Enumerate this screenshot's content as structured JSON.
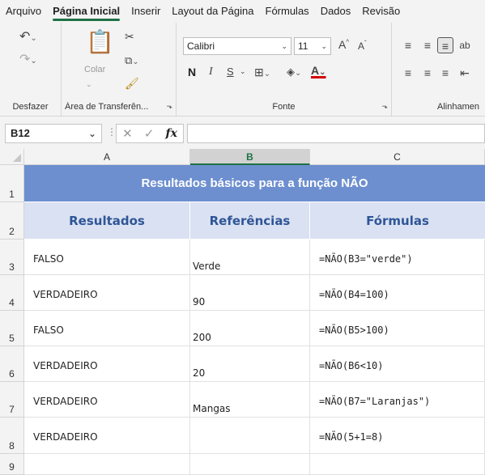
{
  "menu": [
    "Arquivo",
    "Página Inicial",
    "Inserir",
    "Layout da Página",
    "Fórmulas",
    "Dados",
    "Revisão"
  ],
  "ribbon": {
    "undo_group_label": "Desfazer",
    "clipboard": {
      "label": "Área de Transferên...",
      "paste": "Colar"
    },
    "font": {
      "label": "Fonte",
      "name": "Calibri",
      "size": "11",
      "bold": "N",
      "italic": "I",
      "underline": "S",
      "grow": "A",
      "shrink": "A"
    },
    "alignment": {
      "label": "Alinhamen"
    }
  },
  "formula_bar": {
    "name_box": "B12",
    "fx": "fx",
    "formula": ""
  },
  "columns": [
    "A",
    "B",
    "C"
  ],
  "rows": [
    "1",
    "2",
    "3",
    "4",
    "5",
    "6",
    "7",
    "8",
    "9"
  ],
  "sheet": {
    "title": "Resultados básicos para a função NÃO",
    "headers": [
      "Resultados",
      "Referências",
      "Fórmulas"
    ],
    "data": [
      {
        "result": "FALSO",
        "reference": "Verde",
        "formula": "=NÃO(B3=\"verde\")"
      },
      {
        "result": "VERDADEIRO",
        "reference": "90",
        "formula": "=NÃO(B4=100)"
      },
      {
        "result": "FALSO",
        "reference": "200",
        "formula": "=NÃO(B5>100)"
      },
      {
        "result": "VERDADEIRO",
        "reference": "20",
        "formula": "=NÃO(B6<10)"
      },
      {
        "result": "VERDADEIRO",
        "reference": "Mangas",
        "formula": "=NÃO(B7=\"Laranjas\")"
      },
      {
        "result": "VERDADEIRO",
        "reference": "",
        "formula": "=NÃO(5+1=8)"
      }
    ]
  },
  "colors": {
    "title_fill": "#6d8fcf",
    "header_fill": "#d9e1f2",
    "header_text": "#2f5597",
    "accent": "#1e7145"
  }
}
